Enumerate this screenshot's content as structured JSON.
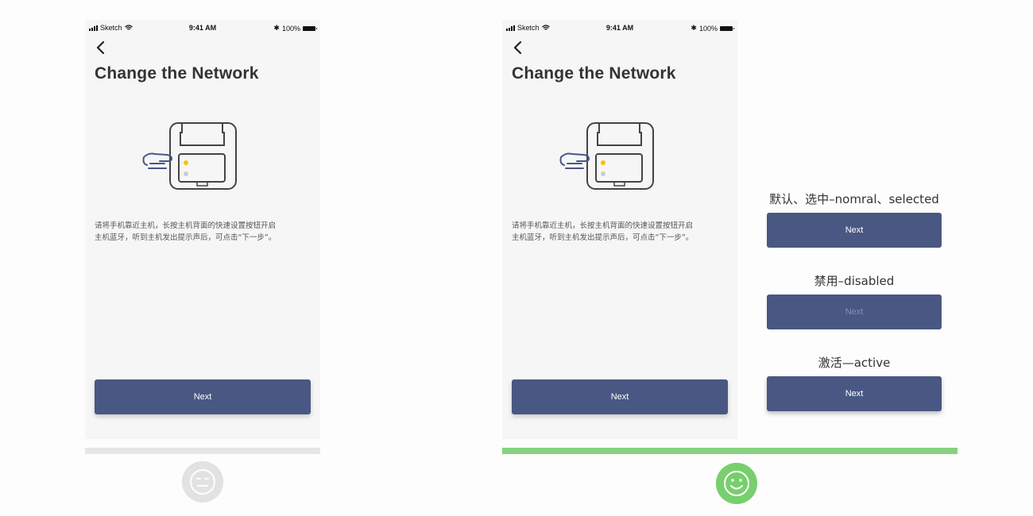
{
  "status_bar": {
    "carrier": "Sketch",
    "time": "9:41 AM",
    "battery": "100%"
  },
  "screens": [
    {
      "title": "Change the Network",
      "instructions_line1": "请将手机靠近主机，长按主机背面的快速设置按钮开启",
      "instructions_line2": "主机蓝牙，听到主机发出提示声后，可点击“下一步”。",
      "next_label": "Next"
    },
    {
      "title": "Change the Network",
      "instructions_line1": "请将手机靠近主机，长按主机背面的快速设置按钮开启",
      "instructions_line2": "主机蓝牙，听到主机发出提示声后，可点击“下一步”。",
      "next_label": "Next"
    }
  ],
  "states": [
    {
      "label": "默认、选中–nomral、selected",
      "button_label": "Next"
    },
    {
      "label": "禁用–disabled",
      "button_label": "Next"
    },
    {
      "label": "激活—active",
      "button_label": "Next"
    }
  ],
  "colors": {
    "button": "#495783",
    "phone_bg": "#f6f6f6",
    "bad_bar": "#e6e6e6",
    "good_bar": "#85d27f",
    "bad_face": "#e2e2e2",
    "good_face": "#78cf6d",
    "led_yellow": "#f5c400"
  },
  "icons": {
    "back": "chevron-left-icon",
    "device": "device-with-finger-icon",
    "neutral": "neutral-face-icon",
    "happy": "smiley-face-icon"
  }
}
